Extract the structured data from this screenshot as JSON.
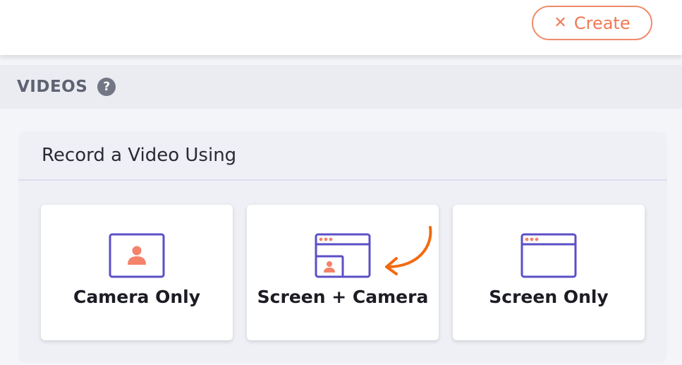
{
  "header": {
    "create_label": "Create",
    "create_icon": "close-icon"
  },
  "section": {
    "title": "VIDEOS",
    "help_icon": "question-circle-icon"
  },
  "panel": {
    "title": "Record a Video Using",
    "options": [
      {
        "label": "Camera Only",
        "icon": "camera-person-icon"
      },
      {
        "label": "Screen + Camera",
        "icon": "screen-with-camera-icon"
      },
      {
        "label": "Screen Only",
        "icon": "browser-window-icon"
      }
    ]
  },
  "colors": {
    "accent_orange": "#ef7a57",
    "icon_purple": "#5b4fc7",
    "arrow_orange": "#f26a10",
    "person_fill": "#f4836a"
  }
}
